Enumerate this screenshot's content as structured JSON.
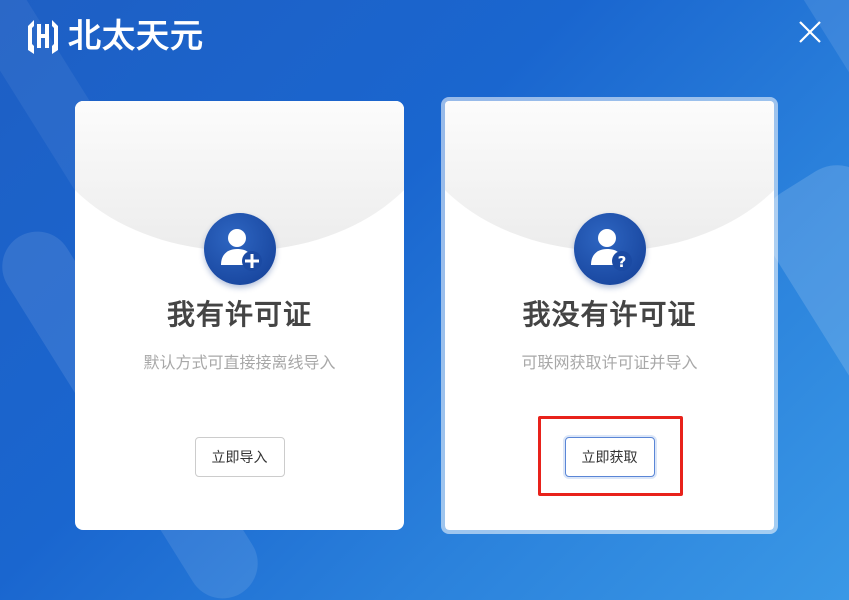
{
  "brand": {
    "name": "北太天元"
  },
  "window": {
    "close": "close"
  },
  "cards": [
    {
      "title": "我有许可证",
      "description": "默认方式可直接接离线导入",
      "button": "立即导入",
      "icon": "user-add-icon"
    },
    {
      "title": "我没有许可证",
      "description": "可联网获取许可证并导入",
      "button": "立即获取",
      "icon": "user-question-icon"
    }
  ],
  "colors": {
    "accent": "#1b4aa3",
    "highlight": "#e8221b"
  }
}
